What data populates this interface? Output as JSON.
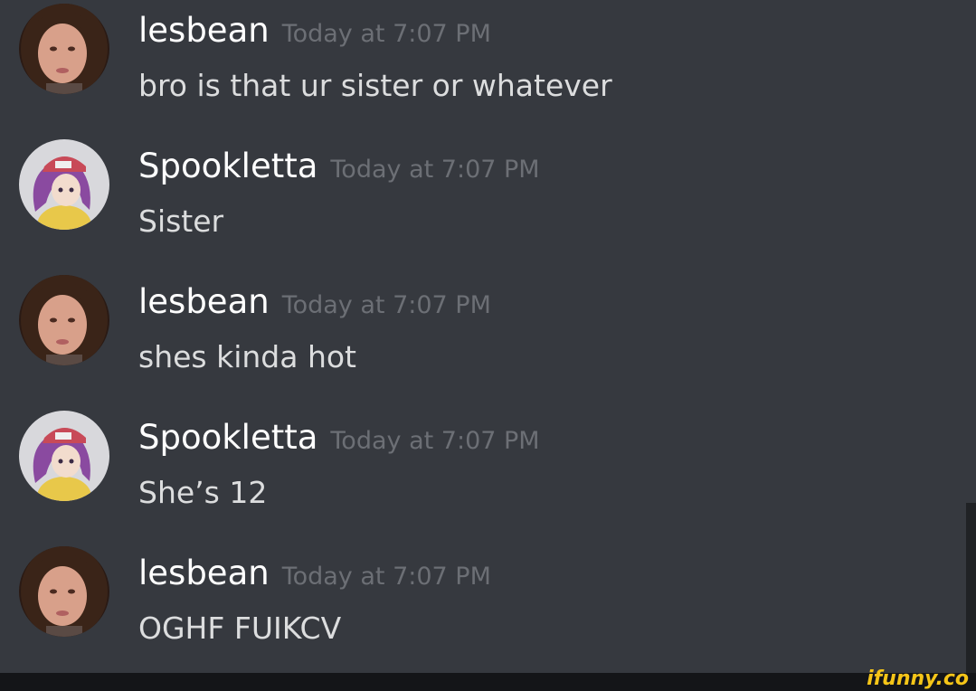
{
  "messages": [
    {
      "username": "lesbean",
      "timestamp": "Today at 7:07 PM",
      "text": "bro is that ur sister or whatever",
      "avatar": "lesbean-avatar"
    },
    {
      "username": "Spookletta",
      "timestamp": "Today at 7:07 PM",
      "text": "Sister",
      "avatar": "spookletta-avatar"
    },
    {
      "username": "lesbean",
      "timestamp": "Today at 7:07 PM",
      "text": "shes kinda hot",
      "avatar": "lesbean-avatar"
    },
    {
      "username": "Spookletta",
      "timestamp": "Today at 7:07 PM",
      "text": "She’s 12",
      "avatar": "spookletta-avatar"
    },
    {
      "username": "lesbean",
      "timestamp": "Today at 7:07 PM",
      "text": "OGHF FUIKCV",
      "avatar": "lesbean-avatar"
    }
  ],
  "watermark": "ifunny.co",
  "colors": {
    "background": "#36393f",
    "username": "#ffffff",
    "timestamp": "#6c6f75",
    "message_text": "#dcddde",
    "watermark": "#f5c518"
  }
}
